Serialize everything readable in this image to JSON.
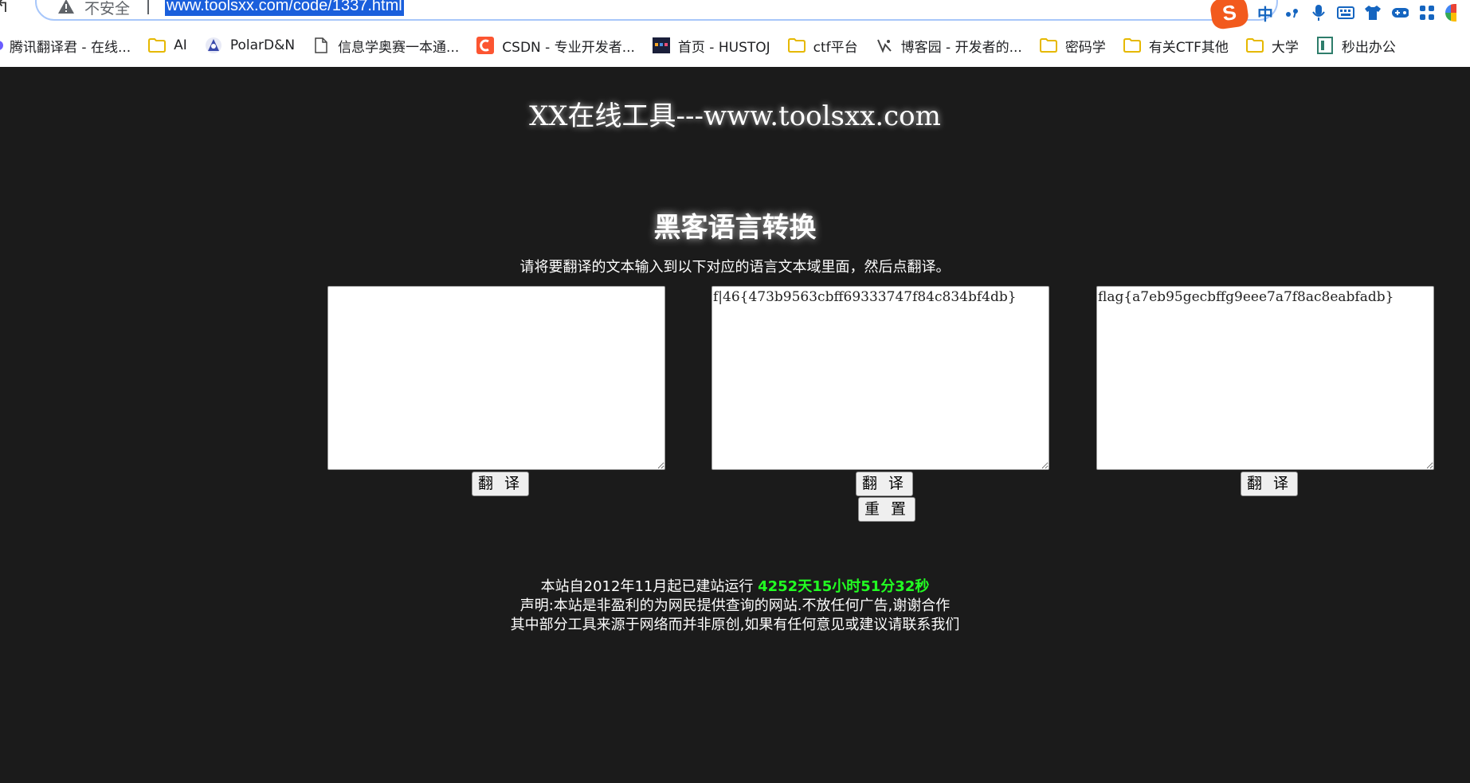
{
  "browser": {
    "security_label": "不安全",
    "url": "www.toolsxx.com/code/1337.html",
    "ime_cn_label": "中",
    "bookmarks": [
      {
        "label": "腾讯翻译君 - 在线...",
        "icon": "translate-icon"
      },
      {
        "label": "AI",
        "icon": "folder-icon"
      },
      {
        "label": "PolarD&N",
        "icon": "polar-logo-icon"
      },
      {
        "label": "信息学奥赛一本通...",
        "icon": "page-icon"
      },
      {
        "label": "CSDN - 专业开发者...",
        "icon": "csdn-logo-icon"
      },
      {
        "label": "首页 - HUSTOJ",
        "icon": "hustoj-logo-icon"
      },
      {
        "label": "ctf平台",
        "icon": "folder-icon"
      },
      {
        "label": "博客园 - 开发者的...",
        "icon": "cnblogs-logo-icon"
      },
      {
        "label": "密码学",
        "icon": "folder-icon"
      },
      {
        "label": "有关CTF其他",
        "icon": "folder-icon"
      },
      {
        "label": "大学",
        "icon": "folder-icon"
      },
      {
        "label": "秒出办公",
        "icon": "app-icon"
      }
    ]
  },
  "page": {
    "site_title": "XX在线工具---www.toolsxx.com",
    "tool_title": "黑客语言转换",
    "instruction": "请将要翻译的文本输入到以下对应的语言文本域里面，然后点翻译。",
    "textareas": {
      "first": "",
      "second": "f|46{473b9563cbff69333747f84c834bf4db}",
      "third": "flag{a7eb95gecbffg9eee7a7f8ac8eabfadb}"
    },
    "translate_label": "翻 译",
    "reset_label": "重 置",
    "footer": {
      "uptime_prefix": "本站自2012年11月起已建站运行",
      "uptime_value": "4252天15小时51分32秒",
      "line2": "声明:本站是非盈利的为网民提供查询的网站.不放任何广告,谢谢合作",
      "line3": "其中部分工具来源于网络而并非原创,如果有任何意见或建议请联系我们"
    }
  },
  "colors": {
    "page_background": "#1b1b1b",
    "uptime_green": "#22ff22",
    "url_highlight": "#1a5fdc",
    "omnibox_border": "#a8c7fa",
    "ime_orange": "#f25a1d"
  }
}
